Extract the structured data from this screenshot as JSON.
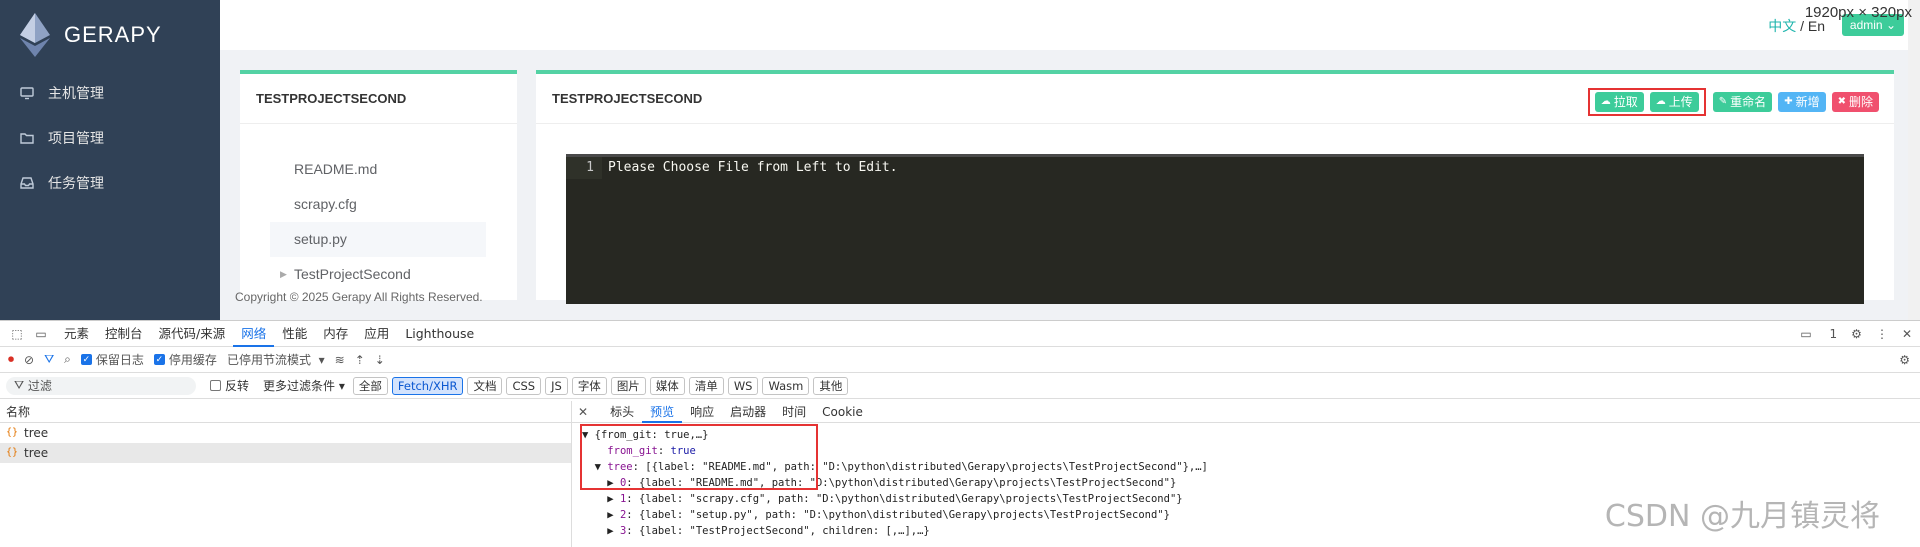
{
  "app": {
    "logo_text": "GERAPY",
    "size_overlay": "1920px × 320px",
    "sidebar": {
      "items": [
        {
          "label": "主机管理",
          "icon": "monitor-icon"
        },
        {
          "label": "项目管理",
          "icon": "folder-icon"
        },
        {
          "label": "任务管理",
          "icon": "inbox-icon"
        }
      ]
    },
    "topbar": {
      "lang_zh": "中文",
      "lang_sep": "/",
      "lang_en": "En",
      "user": "admin"
    },
    "left_panel": {
      "title": "TESTPROJECTSECOND",
      "files": [
        "README.md",
        "scrapy.cfg",
        "setup.py",
        "TestProjectSecond"
      ]
    },
    "right_panel": {
      "title": "TESTPROJECTSECOND",
      "buttons": {
        "pull": "拉取",
        "upload": "上传",
        "rename": "重命名",
        "add": "新增",
        "delete": "删除"
      },
      "editor": {
        "line_no": "1",
        "text": "Please Choose File from Left to Edit."
      }
    },
    "footer": "Copyright © 2025 Gerapy All Rights Reserved."
  },
  "devtools": {
    "tabs": [
      "元素",
      "控制台",
      "源代码/来源",
      "网络",
      "性能",
      "内存",
      "应用",
      "Lighthouse"
    ],
    "active_tab": "网络",
    "issues_count": "1",
    "toolbar": {
      "preserve_log": "保留日志",
      "disable_cache": "停用缓存",
      "throttle": "已停用节流模式"
    },
    "filter": {
      "placeholder": "过滤",
      "invert": "反转",
      "more": "更多过滤条件",
      "chips": [
        "全部",
        "Fetch/XHR",
        "文档",
        "CSS",
        "JS",
        "字体",
        "图片",
        "媒体",
        "清单",
        "WS",
        "Wasm",
        "其他"
      ],
      "active_chip": "Fetch/XHR"
    },
    "requests": {
      "header": "名称",
      "rows": [
        "tree",
        "tree"
      ]
    },
    "detail_tabs": [
      "标头",
      "预览",
      "响应",
      "启动器",
      "时间",
      "Cookie"
    ],
    "active_detail": "预览",
    "preview": {
      "line1": "{from_git: true,…}",
      "line2_key": "from_git",
      "line2_val": "true",
      "line3_key": "tree",
      "line3_val": "[{label: \"README.md\", path: \"D:\\python\\distributed\\Gerapy\\projects\\TestProjectSecond\"},…]",
      "items": [
        {
          "idx": "0",
          "text": "{label: \"README.md\", path: \"D:\\python\\distributed\\Gerapy\\projects\\TestProjectSecond\"}"
        },
        {
          "idx": "1",
          "text": "{label: \"scrapy.cfg\", path: \"D:\\python\\distributed\\Gerapy\\projects\\TestProjectSecond\"}"
        },
        {
          "idx": "2",
          "text": "{label: \"setup.py\", path: \"D:\\python\\distributed\\Gerapy\\projects\\TestProjectSecond\"}"
        },
        {
          "idx": "3",
          "text": "{label: \"TestProjectSecond\", children: [,…],…}"
        }
      ]
    },
    "watermark": "CSDN @九月镇灵将"
  }
}
